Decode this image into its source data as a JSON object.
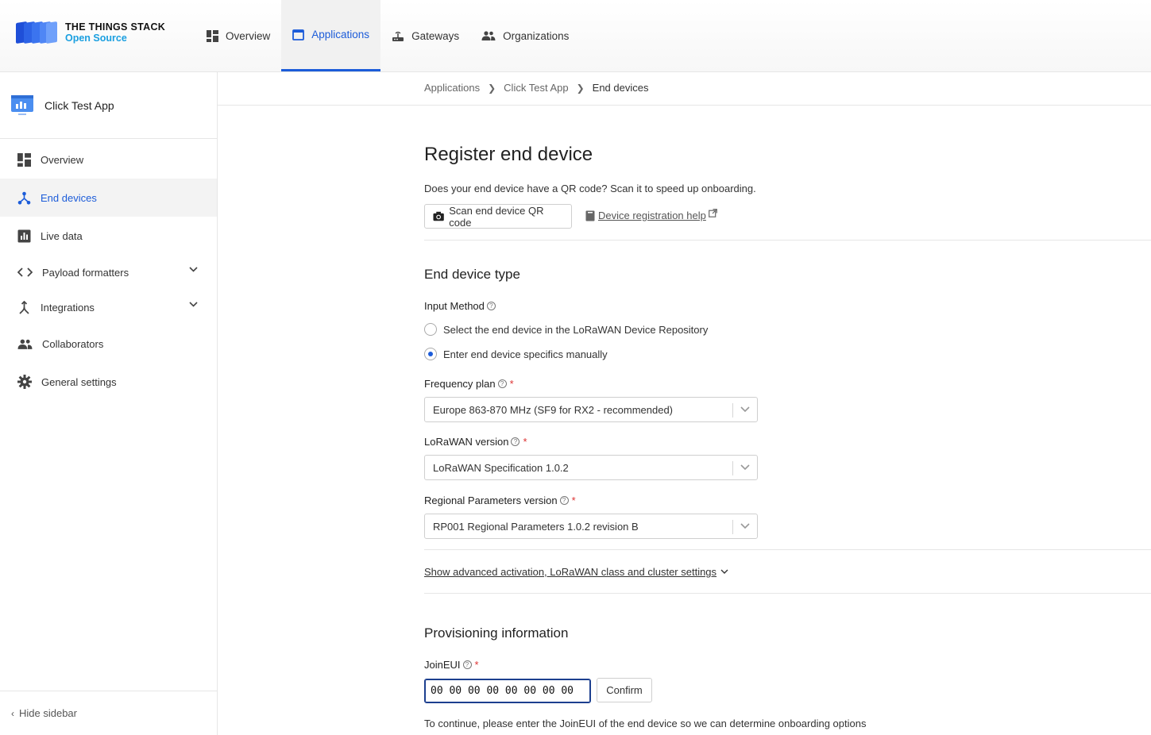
{
  "brand": {
    "line1": "THE THINGS STACK",
    "line2": "Open Source"
  },
  "nav": [
    {
      "label": "Overview",
      "icon": "dashboard-icon"
    },
    {
      "label": "Applications",
      "icon": "applications-icon"
    },
    {
      "label": "Gateways",
      "icon": "gateway-icon"
    },
    {
      "label": "Organizations",
      "icon": "organizations-icon"
    }
  ],
  "sidebar": {
    "app_name": "Click Test App",
    "items": [
      {
        "label": "Overview"
      },
      {
        "label": "End devices"
      },
      {
        "label": "Live data"
      },
      {
        "label": "Payload formatters"
      },
      {
        "label": "Integrations"
      },
      {
        "label": "Collaborators"
      },
      {
        "label": "General settings"
      }
    ],
    "hide_label": "Hide sidebar"
  },
  "breadcrumb": [
    "Applications",
    "Click Test App",
    "End devices"
  ],
  "page": {
    "title": "Register end device",
    "qr_question": "Does your end device have a QR code? Scan it to speed up onboarding.",
    "scan_button": "Scan end device QR code",
    "help_link": "Device registration help"
  },
  "device_type": {
    "title": "End device type",
    "input_method_label": "Input Method",
    "option_repository": "Select the end device in the LoRaWAN Device Repository",
    "option_manual": "Enter end device specifics manually",
    "frequency_plan_label": "Frequency plan",
    "frequency_plan_value": "Europe 863-870 MHz (SF9 for RX2 - recommended)",
    "lorawan_version_label": "LoRaWAN version",
    "lorawan_version_value": "LoRaWAN Specification 1.0.2",
    "regional_params_label": "Regional Parameters version",
    "regional_params_value": "RP001 Regional Parameters 1.0.2 revision B",
    "advanced_link": "Show advanced activation, LoRaWAN class and cluster settings"
  },
  "provisioning": {
    "title": "Provisioning information",
    "join_eui_label": "JoinEUI",
    "join_eui_value": "00 00 00 00 00 00 00 00",
    "confirm_button": "Confirm",
    "continue_text": "To continue, please enter the JoinEUI of the end device so we can determine onboarding options"
  },
  "colors": {
    "accent": "#1c5cd9",
    "required": "#dd3333",
    "brand_blue": "#1a9fe0"
  }
}
